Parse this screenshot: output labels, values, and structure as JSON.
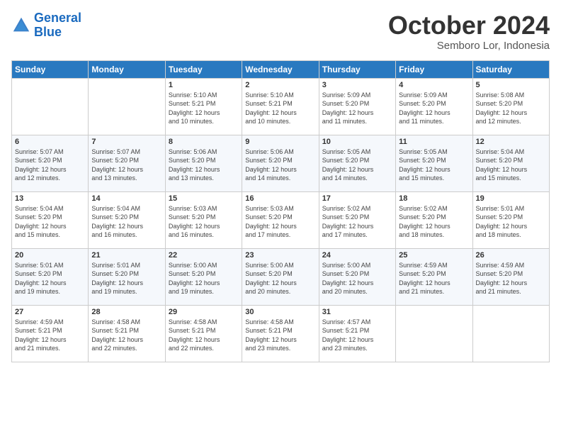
{
  "logo": {
    "text_general": "General",
    "text_blue": "Blue"
  },
  "header": {
    "month": "October 2024",
    "location": "Semboro Lor, Indonesia"
  },
  "days_of_week": [
    "Sunday",
    "Monday",
    "Tuesday",
    "Wednesday",
    "Thursday",
    "Friday",
    "Saturday"
  ],
  "weeks": [
    [
      {
        "day": "",
        "info": ""
      },
      {
        "day": "",
        "info": ""
      },
      {
        "day": "1",
        "info": "Sunrise: 5:10 AM\nSunset: 5:21 PM\nDaylight: 12 hours\nand 10 minutes."
      },
      {
        "day": "2",
        "info": "Sunrise: 5:10 AM\nSunset: 5:21 PM\nDaylight: 12 hours\nand 10 minutes."
      },
      {
        "day": "3",
        "info": "Sunrise: 5:09 AM\nSunset: 5:20 PM\nDaylight: 12 hours\nand 11 minutes."
      },
      {
        "day": "4",
        "info": "Sunrise: 5:09 AM\nSunset: 5:20 PM\nDaylight: 12 hours\nand 11 minutes."
      },
      {
        "day": "5",
        "info": "Sunrise: 5:08 AM\nSunset: 5:20 PM\nDaylight: 12 hours\nand 12 minutes."
      }
    ],
    [
      {
        "day": "6",
        "info": "Sunrise: 5:07 AM\nSunset: 5:20 PM\nDaylight: 12 hours\nand 12 minutes."
      },
      {
        "day": "7",
        "info": "Sunrise: 5:07 AM\nSunset: 5:20 PM\nDaylight: 12 hours\nand 13 minutes."
      },
      {
        "day": "8",
        "info": "Sunrise: 5:06 AM\nSunset: 5:20 PM\nDaylight: 12 hours\nand 13 minutes."
      },
      {
        "day": "9",
        "info": "Sunrise: 5:06 AM\nSunset: 5:20 PM\nDaylight: 12 hours\nand 14 minutes."
      },
      {
        "day": "10",
        "info": "Sunrise: 5:05 AM\nSunset: 5:20 PM\nDaylight: 12 hours\nand 14 minutes."
      },
      {
        "day": "11",
        "info": "Sunrise: 5:05 AM\nSunset: 5:20 PM\nDaylight: 12 hours\nand 15 minutes."
      },
      {
        "day": "12",
        "info": "Sunrise: 5:04 AM\nSunset: 5:20 PM\nDaylight: 12 hours\nand 15 minutes."
      }
    ],
    [
      {
        "day": "13",
        "info": "Sunrise: 5:04 AM\nSunset: 5:20 PM\nDaylight: 12 hours\nand 15 minutes."
      },
      {
        "day": "14",
        "info": "Sunrise: 5:04 AM\nSunset: 5:20 PM\nDaylight: 12 hours\nand 16 minutes."
      },
      {
        "day": "15",
        "info": "Sunrise: 5:03 AM\nSunset: 5:20 PM\nDaylight: 12 hours\nand 16 minutes."
      },
      {
        "day": "16",
        "info": "Sunrise: 5:03 AM\nSunset: 5:20 PM\nDaylight: 12 hours\nand 17 minutes."
      },
      {
        "day": "17",
        "info": "Sunrise: 5:02 AM\nSunset: 5:20 PM\nDaylight: 12 hours\nand 17 minutes."
      },
      {
        "day": "18",
        "info": "Sunrise: 5:02 AM\nSunset: 5:20 PM\nDaylight: 12 hours\nand 18 minutes."
      },
      {
        "day": "19",
        "info": "Sunrise: 5:01 AM\nSunset: 5:20 PM\nDaylight: 12 hours\nand 18 minutes."
      }
    ],
    [
      {
        "day": "20",
        "info": "Sunrise: 5:01 AM\nSunset: 5:20 PM\nDaylight: 12 hours\nand 19 minutes."
      },
      {
        "day": "21",
        "info": "Sunrise: 5:01 AM\nSunset: 5:20 PM\nDaylight: 12 hours\nand 19 minutes."
      },
      {
        "day": "22",
        "info": "Sunrise: 5:00 AM\nSunset: 5:20 PM\nDaylight: 12 hours\nand 19 minutes."
      },
      {
        "day": "23",
        "info": "Sunrise: 5:00 AM\nSunset: 5:20 PM\nDaylight: 12 hours\nand 20 minutes."
      },
      {
        "day": "24",
        "info": "Sunrise: 5:00 AM\nSunset: 5:20 PM\nDaylight: 12 hours\nand 20 minutes."
      },
      {
        "day": "25",
        "info": "Sunrise: 4:59 AM\nSunset: 5:20 PM\nDaylight: 12 hours\nand 21 minutes."
      },
      {
        "day": "26",
        "info": "Sunrise: 4:59 AM\nSunset: 5:20 PM\nDaylight: 12 hours\nand 21 minutes."
      }
    ],
    [
      {
        "day": "27",
        "info": "Sunrise: 4:59 AM\nSunset: 5:21 PM\nDaylight: 12 hours\nand 21 minutes."
      },
      {
        "day": "28",
        "info": "Sunrise: 4:58 AM\nSunset: 5:21 PM\nDaylight: 12 hours\nand 22 minutes."
      },
      {
        "day": "29",
        "info": "Sunrise: 4:58 AM\nSunset: 5:21 PM\nDaylight: 12 hours\nand 22 minutes."
      },
      {
        "day": "30",
        "info": "Sunrise: 4:58 AM\nSunset: 5:21 PM\nDaylight: 12 hours\nand 23 minutes."
      },
      {
        "day": "31",
        "info": "Sunrise: 4:57 AM\nSunset: 5:21 PM\nDaylight: 12 hours\nand 23 minutes."
      },
      {
        "day": "",
        "info": ""
      },
      {
        "day": "",
        "info": ""
      }
    ]
  ]
}
